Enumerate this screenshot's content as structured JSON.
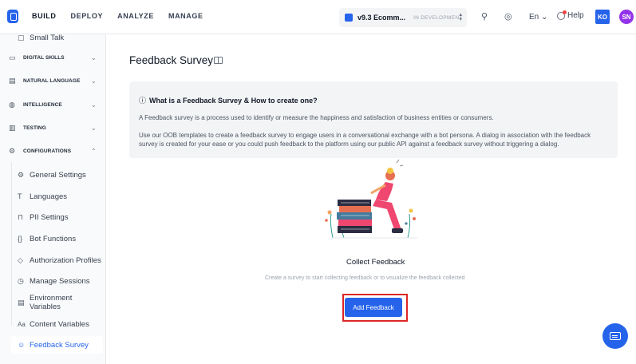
{
  "topbar": {
    "nav": [
      "BUILD",
      "DEPLOY",
      "ANALYZE",
      "MANAGE"
    ],
    "app_name": "v9.3 Ecomm...",
    "app_status": "IN DEVELOPMENT",
    "language": "En",
    "help": "Help",
    "user1": "KO",
    "user2": "SN"
  },
  "sidebar": {
    "partial_item": "Small Talk",
    "sections": [
      {
        "label": "DIGITAL SKILLS",
        "icon": "monitor-icon"
      },
      {
        "label": "NATURAL LANGUAGE",
        "icon": "nlp-icon"
      },
      {
        "label": "INTELLIGENCE",
        "icon": "bulb-icon"
      },
      {
        "label": "TESTING",
        "icon": "clipboard-icon"
      },
      {
        "label": "CONFIGURATIONS",
        "icon": "config-icon"
      }
    ],
    "items": [
      {
        "label": "General Settings",
        "icon": "gear-icon"
      },
      {
        "label": "Languages",
        "icon": "text-icon"
      },
      {
        "label": "PII Settings",
        "icon": "lock-icon"
      },
      {
        "label": "Bot Functions",
        "icon": "braces-icon"
      },
      {
        "label": "Authorization Profiles",
        "icon": "shield-icon"
      },
      {
        "label": "Manage Sessions",
        "icon": "clock-icon"
      },
      {
        "label": "Environment Variables",
        "icon": "document-icon"
      },
      {
        "label": "Content Variables",
        "icon": "font-icon"
      },
      {
        "label": "Feedback Survey",
        "icon": "feedback-icon"
      }
    ]
  },
  "main": {
    "title": "Feedback Survey",
    "info": {
      "heading": "What is a Feedback Survey & How to create one?",
      "p1": "A Feedback survey is a process used to identify or measure the happiness and satisfaction of business entities or consumers.",
      "p2": "Use our OOB templates to create a feedback survey to engage users in a conversational exchange with a bot persona. A dialog in association with the feedback survey is created for your ease or you could push feedback to the platform using our public API against a feedback survey without triggering a dialog."
    },
    "empty_title": "Collect Feedback",
    "empty_desc": "Create a survey to start collecting feedback or to visualize the feedback collected",
    "add_button": "Add Feedback"
  },
  "colors": {
    "accent": "#2563eb",
    "highlight": "#dc2626"
  }
}
